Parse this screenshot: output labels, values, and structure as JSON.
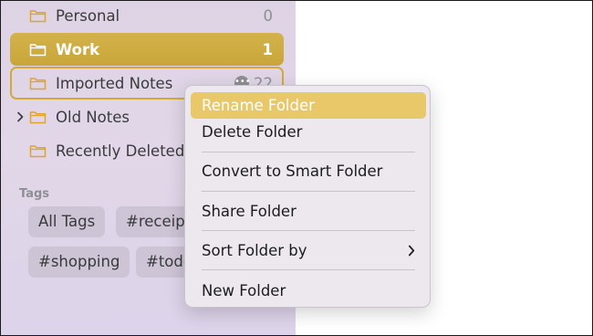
{
  "sidebar": {
    "folders": [
      {
        "label": "Personal",
        "count": "0"
      },
      {
        "label": "Work",
        "count": "1"
      },
      {
        "label": "Imported Notes",
        "count": "22"
      },
      {
        "label": "Old Notes",
        "count": ""
      },
      {
        "label": "Recently Deleted",
        "count": ""
      }
    ],
    "tags_title": "Tags",
    "tags": [
      "All Tags",
      "#receipts",
      "#shopping",
      "#todo"
    ]
  },
  "context_menu": {
    "items": [
      "Rename Folder",
      "Delete Folder",
      "Convert to Smart Folder",
      "Share Folder",
      "Sort Folder by",
      "New Folder"
    ]
  },
  "colors": {
    "accent": "#c9a63b",
    "folder_icon": "#e0a32e",
    "menu_highlight": "#e9c86a"
  },
  "icons": {
    "folder": "folder-icon",
    "disclosure": "chevron-right-icon",
    "more": "ellipsis-circle-icon",
    "submenu": "chevron-right-icon"
  }
}
